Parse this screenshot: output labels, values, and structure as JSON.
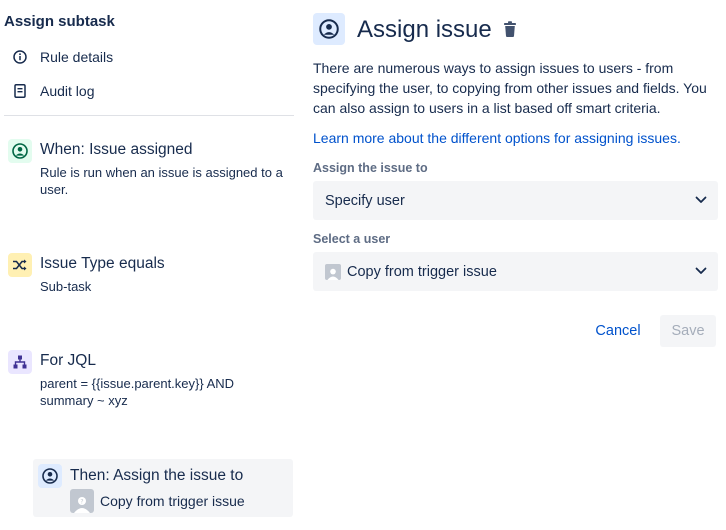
{
  "rule": {
    "title": "Assign subtask",
    "nav": [
      {
        "label": "Rule details",
        "icon": "info-icon"
      },
      {
        "label": "Audit log",
        "icon": "document-icon"
      }
    ]
  },
  "steps": {
    "trigger": {
      "title": "When: Issue assigned",
      "description": "Rule is run when an issue is assigned to a user.",
      "icon": "person-circle-icon"
    },
    "condition": {
      "title": "Issue Type equals",
      "description": "Sub-task",
      "icon": "shuffle-icon"
    },
    "branch": {
      "title": "For JQL",
      "description": "parent = {{issue.parent.key}} AND summary ~ xyz",
      "icon": "hierarchy-icon"
    },
    "action": {
      "title": "Then: Assign the issue to",
      "user": "Copy from trigger issue",
      "icon": "person-circle-icon"
    }
  },
  "panel": {
    "title": "Assign issue",
    "description": "There are numerous ways to assign issues to users - from specifying the user, to copying from other issues and fields. You can also assign to users in a list based off smart criteria.",
    "learn_link": "Learn more about the different options for assigning issues.",
    "assign_label": "Assign the issue to",
    "assign_value": "Specify user",
    "user_label": "Select a user",
    "user_value": "Copy from trigger issue",
    "cancel_label": "Cancel",
    "save_label": "Save"
  },
  "colors": {
    "link": "#0052cc",
    "text": "#172b4d",
    "subtle": "#5e6c84",
    "trigger_badge": "#e3fcef",
    "condition_badge": "#fff0b3",
    "branch_badge": "#eae6ff",
    "action_badge": "#deebff"
  }
}
